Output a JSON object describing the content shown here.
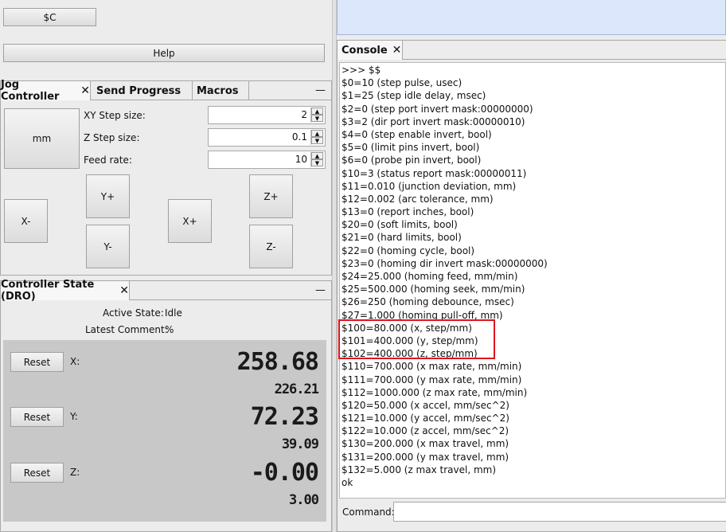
{
  "top_left": {
    "sc_button": "$C",
    "help_button": "Help"
  },
  "jog_panel": {
    "tabs": [
      {
        "label": "Jog Controller",
        "close": "✕"
      },
      {
        "label": "Send Progress"
      },
      {
        "label": "Macros"
      }
    ],
    "minimize": "—",
    "units_button": "mm",
    "xy_step_label": "XY Step size:",
    "xy_step_value": "2",
    "z_step_label": "Z Step size:",
    "z_step_value": "0.1",
    "feed_label": "Feed rate:",
    "feed_value": "10",
    "buttons": {
      "yplus": "Y+",
      "yminus": "Y-",
      "xminus": "X-",
      "xplus": "X+",
      "zplus": "Z+",
      "zminus": "Z-"
    }
  },
  "dro_panel": {
    "tab": "Controller State (DRO)",
    "close": "✕",
    "minimize": "—",
    "active_state_label": "Active State:",
    "active_state_value": "Idle",
    "latest_comment_label": "Latest Comment:",
    "latest_comment_value": "%",
    "axes": [
      {
        "reset": "Reset",
        "label": "X:",
        "work": "258.68",
        "machine": "226.21"
      },
      {
        "reset": "Reset",
        "label": "Y:",
        "work": "72.23",
        "machine": "39.09"
      },
      {
        "reset": "Reset",
        "label": "Z:",
        "work": "-0.00",
        "machine": "3.00"
      }
    ]
  },
  "console": {
    "tab": "Console",
    "close": "✕",
    "lines": [
      ">>> $$",
      "$0=10 (step pulse, usec)",
      "$1=25 (step idle delay, msec)",
      "$2=0 (step port invert mask:00000000)",
      "$3=2 (dir port invert mask:00000010)",
      "$4=0 (step enable invert, bool)",
      "$5=0 (limit pins invert, bool)",
      "$6=0 (probe pin invert, bool)",
      "$10=3 (status report mask:00000011)",
      "$11=0.010 (junction deviation, mm)",
      "$12=0.002 (arc tolerance, mm)",
      "$13=0 (report inches, bool)",
      "$20=0 (soft limits, bool)",
      "$21=0 (hard limits, bool)",
      "$22=0 (homing cycle, bool)",
      "$23=0 (homing dir invert mask:00000000)",
      "$24=25.000 (homing feed, mm/min)",
      "$25=500.000 (homing seek, mm/min)",
      "$26=250 (homing debounce, msec)",
      "$27=1.000 (homing pull-off, mm)",
      "$100=80.000 (x, step/mm)",
      "$101=400.000 (y, step/mm)",
      "$102=400.000 (z, step/mm)",
      "$110=700.000 (x max rate, mm/min)",
      "$111=700.000 (y max rate, mm/min)",
      "$112=1000.000 (z max rate, mm/min)",
      "$120=50.000 (x accel, mm/sec^2)",
      "$121=10.000 (y accel, mm/sec^2)",
      "$122=10.000 (z accel, mm/sec^2)",
      "$130=200.000 (x max travel, mm)",
      "$131=200.000 (y max travel, mm)",
      "$132=5.000 (z max travel, mm)",
      "ok"
    ],
    "highlight_color": "#e0141e",
    "command_label": "Command:",
    "command_value": ""
  },
  "colors": {
    "top_right_bg": "#dde7fb",
    "dro_bg": "#c8c8c8",
    "highlight": "#e0141e"
  }
}
